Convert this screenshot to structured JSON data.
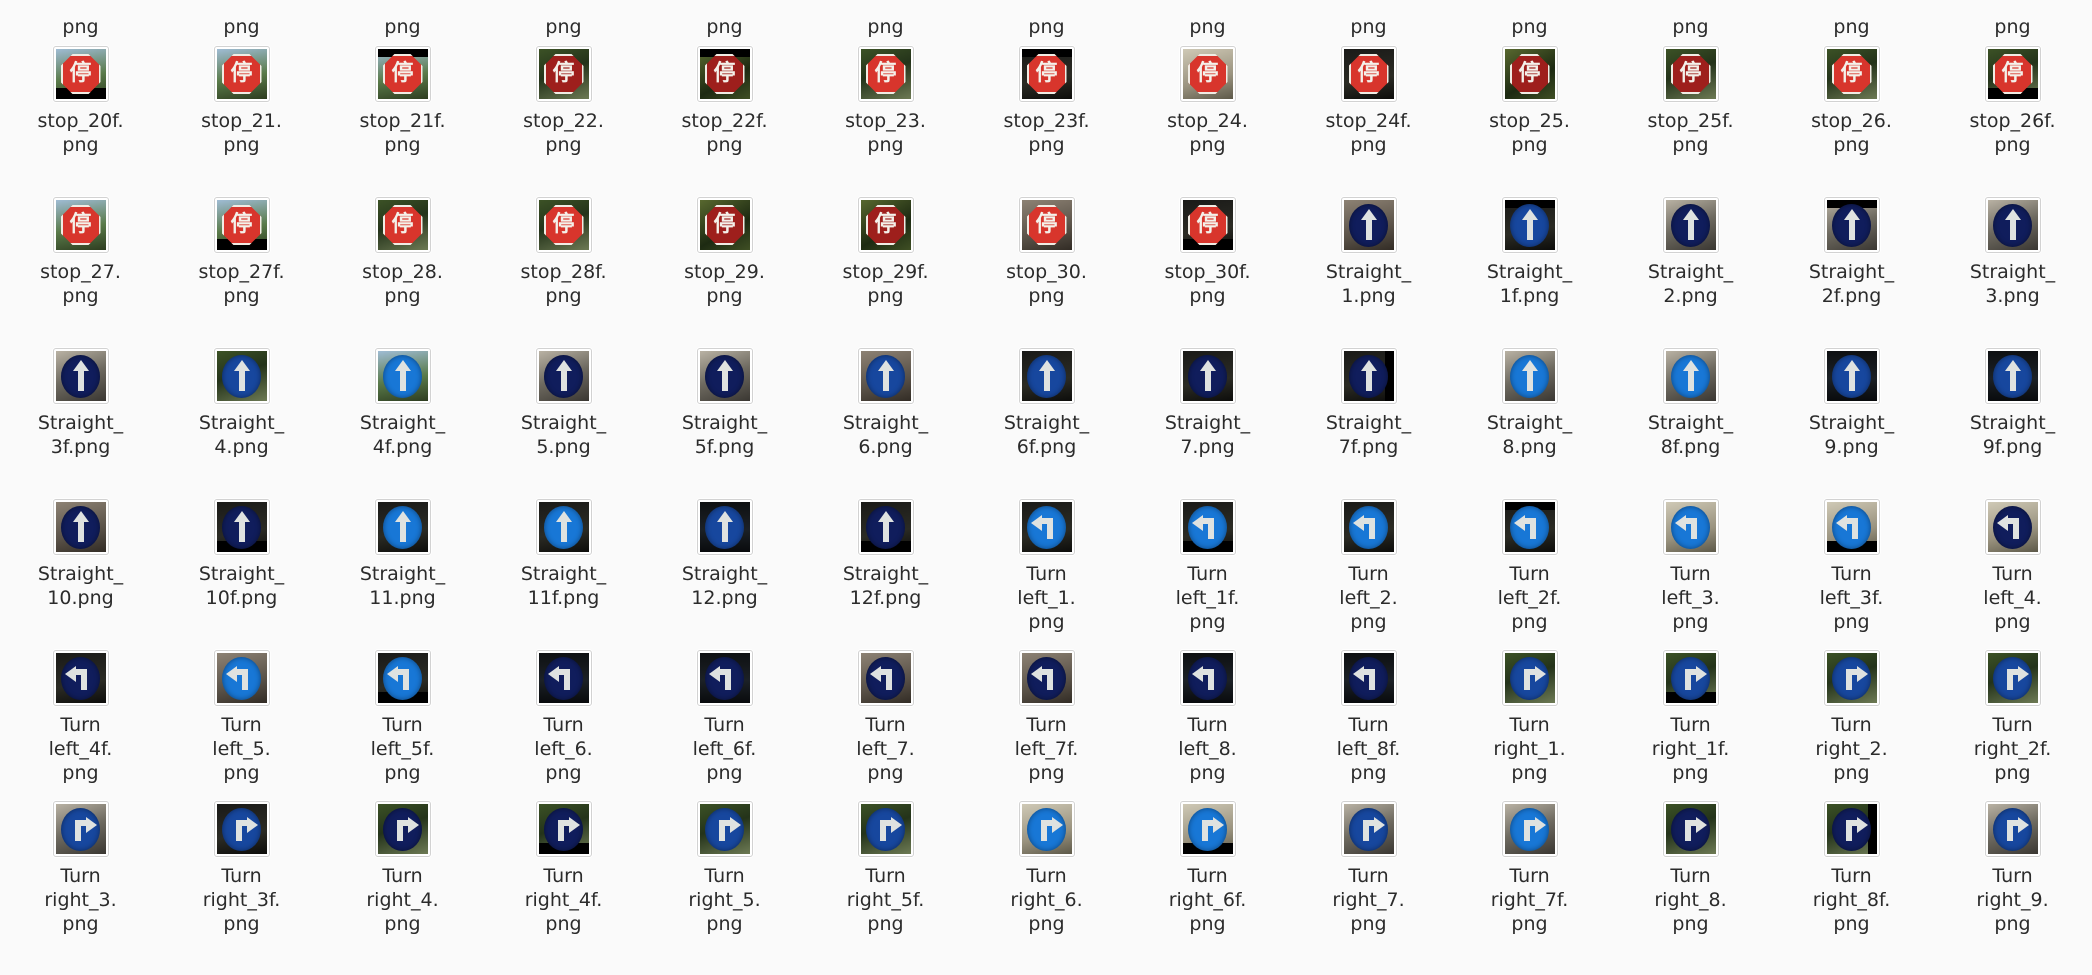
{
  "view": {
    "kind": "file-manager-icon-grid",
    "background_color": "#fafafa",
    "label_color": "#2b2b2b",
    "columns": 13,
    "truncated_label_suffix": "png"
  },
  "partial_top_row": {
    "labels": [
      "png",
      "png",
      "png",
      "png",
      "png",
      "png",
      "png",
      "png",
      "png",
      "png",
      "png",
      "png",
      "png"
    ]
  },
  "rows": [
    {
      "name": "row-stop-20f-26f",
      "items": [
        {
          "label": "stop_20f.\npng",
          "icon": "stop-sign-thumbnail",
          "sign": "stop",
          "tone": "normal",
          "bg": "bg-sky",
          "letterbox": "letterbox-b"
        },
        {
          "label": "stop_21.\npng",
          "icon": "stop-sign-thumbnail",
          "sign": "stop",
          "tone": "normal",
          "bg": "bg-sky",
          "letterbox": ""
        },
        {
          "label": "stop_21f.\npng",
          "icon": "stop-sign-thumbnail",
          "sign": "stop",
          "tone": "normal",
          "bg": "bg-sky",
          "letterbox": "letterbox-t"
        },
        {
          "label": "stop_22.\npng",
          "icon": "stop-sign-thumbnail",
          "sign": "stop",
          "tone": "dark",
          "bg": "bg-foliage",
          "letterbox": ""
        },
        {
          "label": "stop_22f.\npng",
          "icon": "stop-sign-thumbnail",
          "sign": "stop",
          "tone": "dark",
          "bg": "bg-foliage2",
          "letterbox": "letterbox-t"
        },
        {
          "label": "stop_23.\npng",
          "icon": "stop-sign-thumbnail",
          "sign": "stop",
          "tone": "normal",
          "bg": "bg-foliage",
          "letterbox": ""
        },
        {
          "label": "stop_23f.\npng",
          "icon": "stop-sign-thumbnail",
          "sign": "stop",
          "tone": "normal",
          "bg": "bg-dark",
          "letterbox": "letterbox-t"
        },
        {
          "label": "stop_24.\npng",
          "icon": "stop-sign-thumbnail",
          "sign": "stop",
          "tone": "normal",
          "bg": "bg-pale",
          "letterbox": ""
        },
        {
          "label": "stop_24f.\npng",
          "icon": "stop-sign-thumbnail",
          "sign": "stop",
          "tone": "normal",
          "bg": "bg-dark",
          "letterbox": ""
        },
        {
          "label": "stop_25.\npng",
          "icon": "stop-sign-thumbnail",
          "sign": "stop",
          "tone": "dark",
          "bg": "bg-foliage2",
          "letterbox": ""
        },
        {
          "label": "stop_25f.\npng",
          "icon": "stop-sign-thumbnail",
          "sign": "stop",
          "tone": "dark",
          "bg": "bg-foliage",
          "letterbox": ""
        },
        {
          "label": "stop_26.\npng",
          "icon": "stop-sign-thumbnail",
          "sign": "stop",
          "tone": "normal",
          "bg": "bg-foliage",
          "letterbox": ""
        },
        {
          "label": "stop_26f.\npng",
          "icon": "stop-sign-thumbnail",
          "sign": "stop",
          "tone": "normal",
          "bg": "bg-foliage",
          "letterbox": "letterbox-b"
        }
      ]
    },
    {
      "name": "row-stop-27-straight-3",
      "items": [
        {
          "label": "stop_27.\npng",
          "icon": "stop-sign-thumbnail",
          "sign": "stop",
          "tone": "normal",
          "bg": "bg-sky",
          "letterbox": ""
        },
        {
          "label": "stop_27f.\npng",
          "icon": "stop-sign-thumbnail",
          "sign": "stop",
          "tone": "normal",
          "bg": "bg-sky",
          "letterbox": "letterbox-b"
        },
        {
          "label": "stop_28.\npng",
          "icon": "stop-sign-thumbnail",
          "sign": "stop",
          "tone": "normal",
          "bg": "bg-foliage",
          "letterbox": ""
        },
        {
          "label": "stop_28f.\npng",
          "icon": "stop-sign-thumbnail",
          "sign": "stop",
          "tone": "normal",
          "bg": "bg-foliage",
          "letterbox": ""
        },
        {
          "label": "stop_29.\npng",
          "icon": "stop-sign-thumbnail",
          "sign": "stop",
          "tone": "dark",
          "bg": "bg-foliage2",
          "letterbox": ""
        },
        {
          "label": "stop_29f.\npng",
          "icon": "stop-sign-thumbnail",
          "sign": "stop",
          "tone": "dark",
          "bg": "bg-foliage2",
          "letterbox": ""
        },
        {
          "label": "stop_30.\npng",
          "icon": "stop-sign-thumbnail",
          "sign": "stop",
          "tone": "normal",
          "bg": "bg-wall",
          "letterbox": ""
        },
        {
          "label": "stop_30f.\npng",
          "icon": "stop-sign-thumbnail",
          "sign": "stop",
          "tone": "normal",
          "bg": "bg-dark",
          "letterbox": "letterbox-b"
        },
        {
          "label": "Straight_\n1.png",
          "icon": "straight-ahead-sign-thumbnail",
          "sign": "straight",
          "tone": "deep",
          "bg": "bg-wall",
          "letterbox": ""
        },
        {
          "label": "Straight_\n1f.png",
          "icon": "straight-ahead-sign-thumbnail",
          "sign": "straight",
          "tone": "mid",
          "bg": "bg-dark",
          "letterbox": "letterbox-t"
        },
        {
          "label": "Straight_\n2.png",
          "icon": "straight-ahead-sign-thumbnail",
          "sign": "straight",
          "tone": "deep",
          "bg": "bg-urban",
          "letterbox": ""
        },
        {
          "label": "Straight_\n2f.png",
          "icon": "straight-ahead-sign-thumbnail",
          "sign": "straight",
          "tone": "deep",
          "bg": "bg-urban",
          "letterbox": "letterbox-t"
        },
        {
          "label": "Straight_\n3.png",
          "icon": "straight-ahead-sign-thumbnail",
          "sign": "straight",
          "tone": "deep",
          "bg": "bg-urban",
          "letterbox": ""
        }
      ]
    },
    {
      "name": "row-straight-3f-9f",
      "items": [
        {
          "label": "Straight_\n3f.png",
          "icon": "straight-ahead-sign-thumbnail",
          "sign": "straight",
          "tone": "deep",
          "bg": "bg-urban",
          "letterbox": ""
        },
        {
          "label": "Straight_\n4.png",
          "icon": "straight-ahead-sign-thumbnail",
          "sign": "straight",
          "tone": "mid",
          "bg": "bg-foliage",
          "letterbox": ""
        },
        {
          "label": "Straight_\n4f.png",
          "icon": "straight-ahead-sign-thumbnail",
          "sign": "straight",
          "tone": "bright",
          "bg": "bg-sky",
          "letterbox": ""
        },
        {
          "label": "Straight_\n5.png",
          "icon": "straight-ahead-sign-thumbnail",
          "sign": "straight",
          "tone": "deep",
          "bg": "bg-urban",
          "letterbox": ""
        },
        {
          "label": "Straight_\n5f.png",
          "icon": "straight-ahead-sign-thumbnail",
          "sign": "straight",
          "tone": "deep",
          "bg": "bg-urban",
          "letterbox": ""
        },
        {
          "label": "Straight_\n6.png",
          "icon": "straight-ahead-sign-thumbnail",
          "sign": "straight",
          "tone": "mid",
          "bg": "bg-wall",
          "letterbox": ""
        },
        {
          "label": "Straight_\n6f.png",
          "icon": "straight-ahead-sign-thumbnail",
          "sign": "straight",
          "tone": "mid",
          "bg": "bg-dark",
          "letterbox": ""
        },
        {
          "label": "Straight_\n7.png",
          "icon": "straight-ahead-sign-thumbnail",
          "sign": "straight",
          "tone": "deep",
          "bg": "bg-dark",
          "letterbox": ""
        },
        {
          "label": "Straight_\n7f.png",
          "icon": "straight-ahead-sign-thumbnail",
          "sign": "straight",
          "tone": "deep",
          "bg": "bg-dark",
          "letterbox": "letterbox-r"
        },
        {
          "label": "Straight_\n8.png",
          "icon": "straight-ahead-sign-thumbnail",
          "sign": "straight",
          "tone": "bright",
          "bg": "bg-urban",
          "letterbox": ""
        },
        {
          "label": "Straight_\n8f.png",
          "icon": "straight-ahead-sign-thumbnail",
          "sign": "straight",
          "tone": "bright",
          "bg": "bg-urban",
          "letterbox": ""
        },
        {
          "label": "Straight_\n9.png",
          "icon": "straight-ahead-sign-thumbnail",
          "sign": "straight",
          "tone": "mid",
          "bg": "bg-night",
          "letterbox": ""
        },
        {
          "label": "Straight_\n9f.png",
          "icon": "straight-ahead-sign-thumbnail",
          "sign": "straight",
          "tone": "mid",
          "bg": "bg-night",
          "letterbox": ""
        }
      ]
    },
    {
      "name": "row-straight-10-turnleft-4",
      "items": [
        {
          "label": "Straight_\n10.png",
          "icon": "straight-ahead-sign-thumbnail",
          "sign": "straight",
          "tone": "deep",
          "bg": "bg-wall",
          "letterbox": ""
        },
        {
          "label": "Straight_\n10f.png",
          "icon": "straight-ahead-sign-thumbnail",
          "sign": "straight",
          "tone": "deep",
          "bg": "bg-dark",
          "letterbox": "letterbox-b"
        },
        {
          "label": "Straight_\n11.png",
          "icon": "straight-ahead-sign-thumbnail",
          "sign": "straight",
          "tone": "bright",
          "bg": "bg-dark",
          "letterbox": ""
        },
        {
          "label": "Straight_\n11f.png",
          "icon": "straight-ahead-sign-thumbnail",
          "sign": "straight",
          "tone": "bright",
          "bg": "bg-dark",
          "letterbox": ""
        },
        {
          "label": "Straight_\n12.png",
          "icon": "straight-ahead-sign-thumbnail",
          "sign": "straight",
          "tone": "mid",
          "bg": "bg-night",
          "letterbox": ""
        },
        {
          "label": "Straight_\n12f.png",
          "icon": "straight-ahead-sign-thumbnail",
          "sign": "straight",
          "tone": "deep",
          "bg": "bg-dark",
          "letterbox": "letterbox-b"
        },
        {
          "label": "Turn\nleft_1.\npng",
          "icon": "turn-left-sign-thumbnail",
          "sign": "left",
          "tone": "bright",
          "bg": "bg-dark",
          "letterbox": ""
        },
        {
          "label": "Turn\nleft_1f.\npng",
          "icon": "turn-left-sign-thumbnail",
          "sign": "left",
          "tone": "bright",
          "bg": "bg-dark",
          "letterbox": "letterbox-b"
        },
        {
          "label": "Turn\nleft_2.\npng",
          "icon": "turn-left-sign-thumbnail",
          "sign": "left",
          "tone": "bright",
          "bg": "bg-dark",
          "letterbox": ""
        },
        {
          "label": "Turn\nleft_2f.\npng",
          "icon": "turn-left-sign-thumbnail",
          "sign": "left",
          "tone": "bright",
          "bg": "bg-dark",
          "letterbox": "letterbox-t"
        },
        {
          "label": "Turn\nleft_3.\npng",
          "icon": "turn-left-sign-thumbnail",
          "sign": "left",
          "tone": "bright",
          "bg": "bg-pale",
          "letterbox": ""
        },
        {
          "label": "Turn\nleft_3f.\npng",
          "icon": "turn-left-sign-thumbnail",
          "sign": "left",
          "tone": "bright",
          "bg": "bg-pale",
          "letterbox": "letterbox-b"
        },
        {
          "label": "Turn\nleft_4.\npng",
          "icon": "turn-left-sign-thumbnail",
          "sign": "left",
          "tone": "deep",
          "bg": "bg-pale",
          "letterbox": ""
        }
      ]
    },
    {
      "name": "row-turnleft-4f-turnright-2f",
      "items": [
        {
          "label": "Turn\nleft_4f.\npng",
          "icon": "turn-left-sign-thumbnail",
          "sign": "left",
          "tone": "deep",
          "bg": "bg-dark",
          "letterbox": ""
        },
        {
          "label": "Turn\nleft_5.\npng",
          "icon": "turn-left-sign-thumbnail",
          "sign": "left",
          "tone": "bright",
          "bg": "bg-wall",
          "letterbox": ""
        },
        {
          "label": "Turn\nleft_5f.\npng",
          "icon": "turn-left-sign-thumbnail",
          "sign": "left",
          "tone": "bright",
          "bg": "bg-dark",
          "letterbox": "letterbox-b"
        },
        {
          "label": "Turn\nleft_6.\npng",
          "icon": "turn-left-sign-thumbnail",
          "sign": "left",
          "tone": "deep",
          "bg": "bg-night",
          "letterbox": ""
        },
        {
          "label": "Turn\nleft_6f.\npng",
          "icon": "turn-left-sign-thumbnail",
          "sign": "left",
          "tone": "deep",
          "bg": "bg-night",
          "letterbox": ""
        },
        {
          "label": "Turn\nleft_7.\npng",
          "icon": "turn-left-sign-thumbnail",
          "sign": "left",
          "tone": "deep",
          "bg": "bg-wall",
          "letterbox": ""
        },
        {
          "label": "Turn\nleft_7f.\npng",
          "icon": "turn-left-sign-thumbnail",
          "sign": "left",
          "tone": "deep",
          "bg": "bg-wall",
          "letterbox": ""
        },
        {
          "label": "Turn\nleft_8.\npng",
          "icon": "turn-left-sign-thumbnail",
          "sign": "left",
          "tone": "deep",
          "bg": "bg-night",
          "letterbox": ""
        },
        {
          "label": "Turn\nleft_8f.\npng",
          "icon": "turn-left-sign-thumbnail",
          "sign": "left",
          "tone": "deep",
          "bg": "bg-night",
          "letterbox": ""
        },
        {
          "label": "Turn\nright_1.\npng",
          "icon": "turn-right-sign-thumbnail",
          "sign": "right",
          "tone": "mid",
          "bg": "bg-foliage",
          "letterbox": ""
        },
        {
          "label": "Turn\nright_1f.\npng",
          "icon": "turn-right-sign-thumbnail",
          "sign": "right",
          "tone": "mid",
          "bg": "bg-foliage",
          "letterbox": "letterbox-b"
        },
        {
          "label": "Turn\nright_2.\npng",
          "icon": "turn-right-sign-thumbnail",
          "sign": "right",
          "tone": "mid",
          "bg": "bg-foliage",
          "letterbox": ""
        },
        {
          "label": "Turn\nright_2f.\npng",
          "icon": "turn-right-sign-thumbnail",
          "sign": "right",
          "tone": "mid",
          "bg": "bg-foliage",
          "letterbox": ""
        }
      ]
    },
    {
      "name": "row-turnright-3-9",
      "items": [
        {
          "label": "Turn\nright_3.\npng",
          "icon": "turn-right-sign-thumbnail",
          "sign": "right",
          "tone": "mid",
          "bg": "bg-urban",
          "letterbox": ""
        },
        {
          "label": "Turn\nright_3f.\npng",
          "icon": "turn-right-sign-thumbnail",
          "sign": "right",
          "tone": "mid",
          "bg": "bg-dark",
          "letterbox": ""
        },
        {
          "label": "Turn\nright_4.\npng",
          "icon": "turn-right-sign-thumbnail",
          "sign": "right",
          "tone": "deep",
          "bg": "bg-foliage",
          "letterbox": ""
        },
        {
          "label": "Turn\nright_4f.\npng",
          "icon": "turn-right-sign-thumbnail",
          "sign": "right",
          "tone": "deep",
          "bg": "bg-foliage",
          "letterbox": "letterbox-b"
        },
        {
          "label": "Turn\nright_5.\npng",
          "icon": "turn-right-sign-thumbnail",
          "sign": "right",
          "tone": "mid",
          "bg": "bg-foliage",
          "letterbox": ""
        },
        {
          "label": "Turn\nright_5f.\npng",
          "icon": "turn-right-sign-thumbnail",
          "sign": "right",
          "tone": "mid",
          "bg": "bg-foliage",
          "letterbox": ""
        },
        {
          "label": "Turn\nright_6.\npng",
          "icon": "turn-right-sign-thumbnail",
          "sign": "right",
          "tone": "bright",
          "bg": "bg-pale",
          "letterbox": ""
        },
        {
          "label": "Turn\nright_6f.\npng",
          "icon": "turn-right-sign-thumbnail",
          "sign": "right",
          "tone": "bright",
          "bg": "bg-pale",
          "letterbox": "letterbox-b"
        },
        {
          "label": "Turn\nright_7.\npng",
          "icon": "turn-right-sign-thumbnail",
          "sign": "right",
          "tone": "mid",
          "bg": "bg-urban",
          "letterbox": ""
        },
        {
          "label": "Turn\nright_7f.\npng",
          "icon": "turn-right-sign-thumbnail",
          "sign": "right",
          "tone": "bright",
          "bg": "bg-urban",
          "letterbox": ""
        },
        {
          "label": "Turn\nright_8.\npng",
          "icon": "turn-right-sign-thumbnail",
          "sign": "right",
          "tone": "deep",
          "bg": "bg-foliage",
          "letterbox": ""
        },
        {
          "label": "Turn\nright_8f.\npng",
          "icon": "turn-right-sign-thumbnail",
          "sign": "right",
          "tone": "deep",
          "bg": "bg-foliage",
          "letterbox": "letterbox-r"
        },
        {
          "label": "Turn\nright_9.\npng",
          "icon": "turn-right-sign-thumbnail",
          "sign": "right",
          "tone": "mid",
          "bg": "bg-urban",
          "letterbox": ""
        }
      ]
    }
  ],
  "glyphs": {
    "stop_character": "停"
  }
}
